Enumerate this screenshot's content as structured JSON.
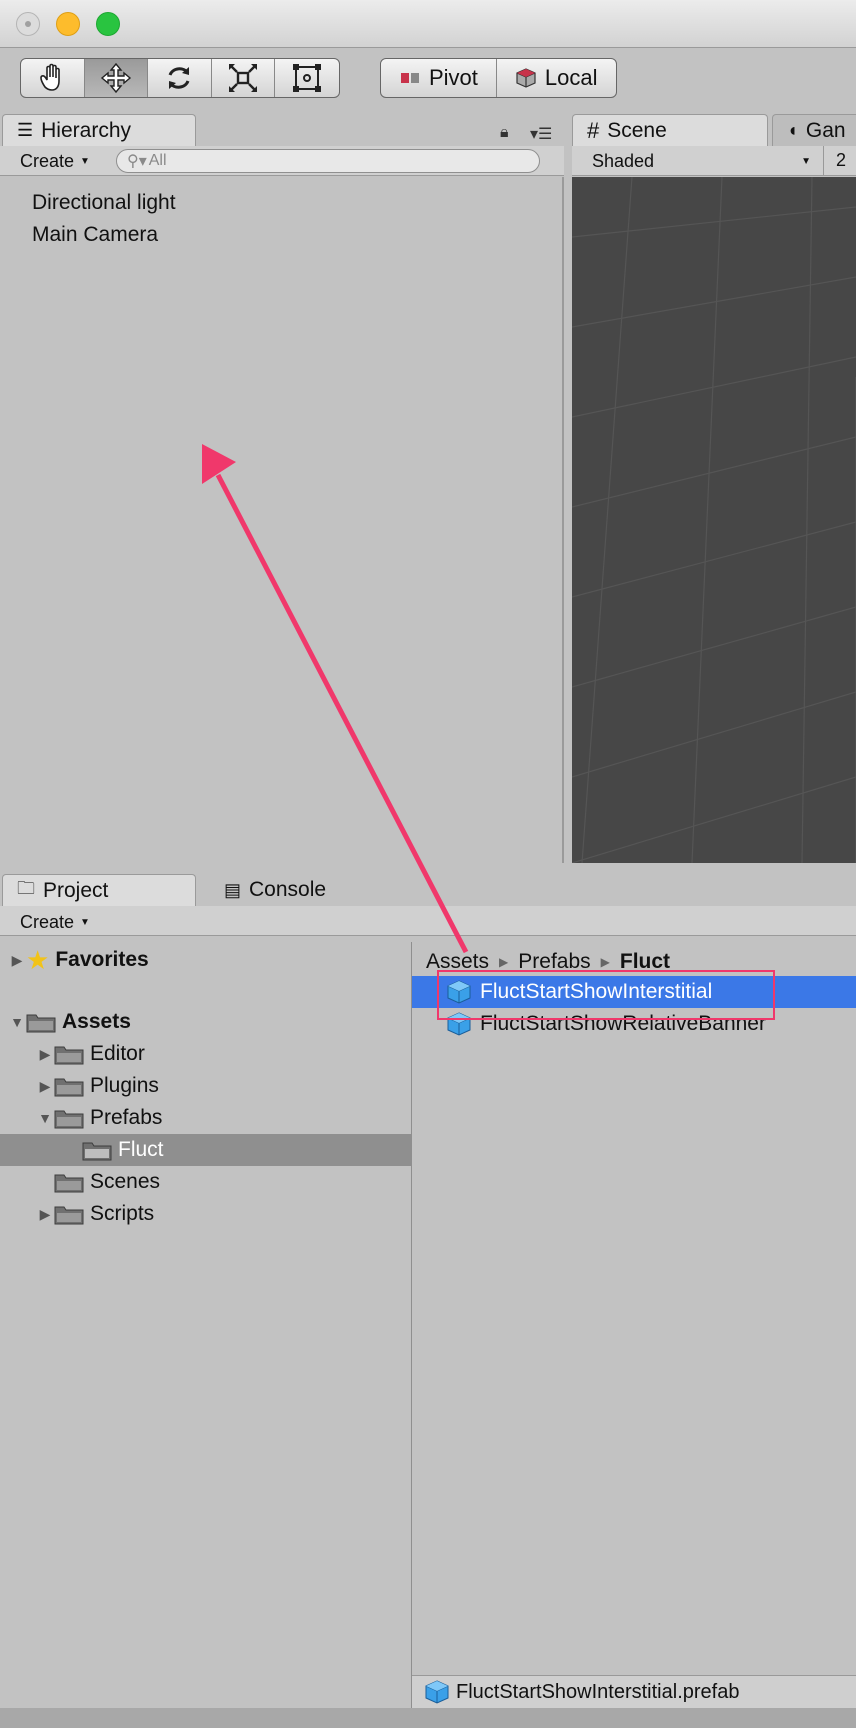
{
  "window": {
    "buttons": [
      "close",
      "minimize",
      "maximize"
    ]
  },
  "toolbar": {
    "tools": [
      {
        "name": "hand-tool",
        "icon": "hand-icon",
        "active": false
      },
      {
        "name": "move-tool",
        "icon": "move-icon",
        "active": true
      },
      {
        "name": "rotate-tool",
        "icon": "rotate-icon",
        "active": false
      },
      {
        "name": "scale-tool",
        "icon": "scale-icon",
        "active": false
      },
      {
        "name": "rect-tool",
        "icon": "rect-icon",
        "active": false
      }
    ],
    "pivot_label": "Pivot",
    "local_label": "Local"
  },
  "hierarchy": {
    "tab_label": "Hierarchy",
    "create_label": "Create",
    "search_placeholder": "All",
    "items": [
      "Directional light",
      "Main Camera"
    ]
  },
  "scene": {
    "tab_label": "Scene",
    "game_tab_label": "Gan",
    "shading_mode": "Shaded",
    "extra": "2"
  },
  "project": {
    "tab_label": "Project",
    "console_tab_label": "Console",
    "create_label": "Create",
    "tree": {
      "favorites": "Favorites",
      "assets": "Assets",
      "editor": "Editor",
      "plugins": "Plugins",
      "prefabs": "Prefabs",
      "fluct": "Fluct",
      "scenes": "Scenes",
      "scripts": "Scripts"
    },
    "breadcrumb": [
      "Assets",
      "Prefabs",
      "Fluct"
    ],
    "assets": [
      "FluctStartShowInterstitial",
      "FluctStartShowRelativeBanner"
    ],
    "selected_asset": "FluctStartShowInterstitial",
    "status_file": "FluctStartShowInterstitial.prefab"
  },
  "colors": {
    "selection": "#3b78e7",
    "annotation": "#f0386b",
    "scene_bg": "#474747",
    "panel_bg": "#c2c2c2"
  }
}
